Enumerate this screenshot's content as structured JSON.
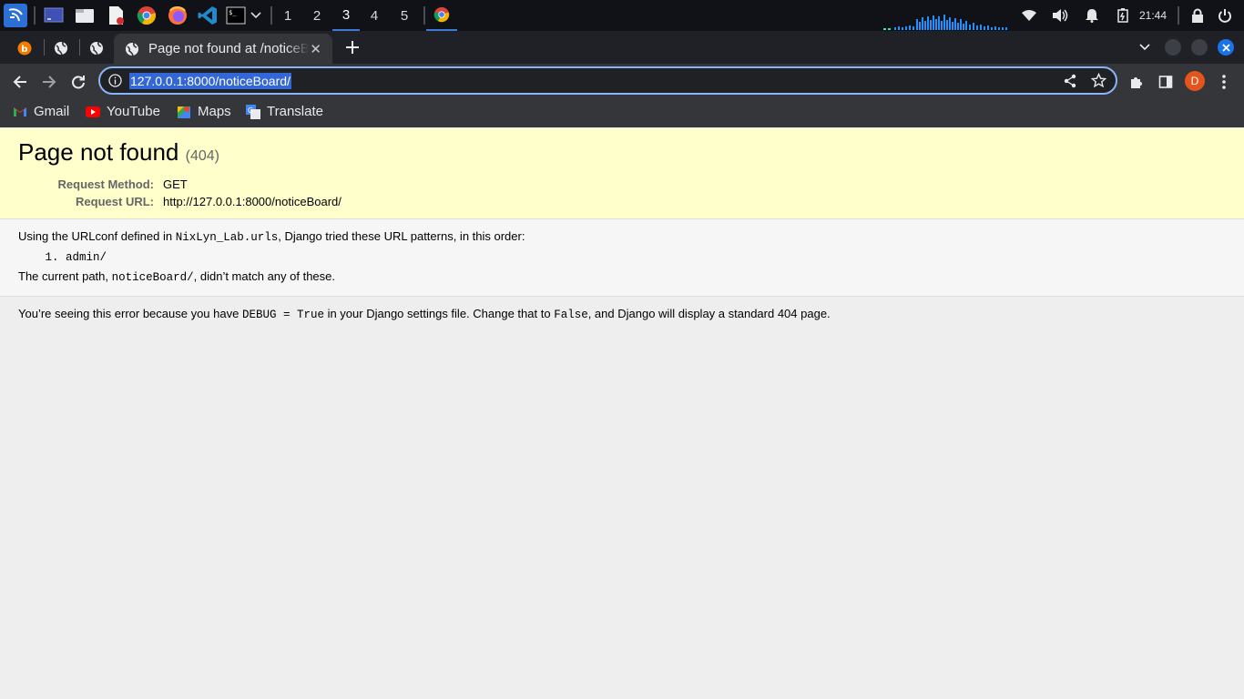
{
  "taskbar": {
    "workspaces": [
      "1",
      "2",
      "3",
      "4",
      "5"
    ],
    "active_workspace": "3",
    "clock": "21:44",
    "icons": [
      "kali-menu-icon",
      "desktop-icon",
      "file-manager-icon",
      "text-editor-icon",
      "chrome-icon",
      "firefox-icon",
      "vscode-icon",
      "terminal-icon"
    ],
    "colors": {
      "accent": "#3d7ad8",
      "background": "#101217"
    }
  },
  "browser": {
    "active_tab_title": "Page not found at /noticeBoard/",
    "url": "127.0.0.1:8000/noticeBoard/",
    "profile_initial": "D",
    "colors": {
      "profile": "#e5541b",
      "focus_ring": "#8ab4f8",
      "close_button": "#1a73e8"
    },
    "bookmarks": [
      {
        "label": "Gmail",
        "icon": "gmail-icon"
      },
      {
        "label": "YouTube",
        "icon": "youtube-icon"
      },
      {
        "label": "Maps",
        "icon": "maps-icon"
      },
      {
        "label": "Translate",
        "icon": "translate-icon"
      }
    ]
  },
  "page": {
    "title": "Page not found",
    "status": "(404)",
    "request_method_label": "Request Method:",
    "request_method": "GET",
    "request_url_label": "Request URL:",
    "request_url": "http://127.0.0.1:8000/noticeBoard/",
    "info_prefix": "Using the URLconf defined in ",
    "urlconf": "NixLyn_Lab.urls",
    "info_suffix": ", Django tried these URL patterns, in this order:",
    "patterns": [
      "admin/"
    ],
    "current_path_prefix": "The current path, ",
    "current_path": "noticeBoard/",
    "current_path_suffix": ", didn’t match any of these.",
    "explanation_1": "You’re seeing this error because you have ",
    "debug_code": "DEBUG = True",
    "explanation_2": " in your Django settings file. Change that to ",
    "false_code": "False",
    "explanation_3": ", and Django will display a standard 404 page.",
    "colors": {
      "summary_bg": "#ffffcc",
      "info_bg": "#f6f6f6",
      "page_bg": "#eeeeee"
    }
  }
}
